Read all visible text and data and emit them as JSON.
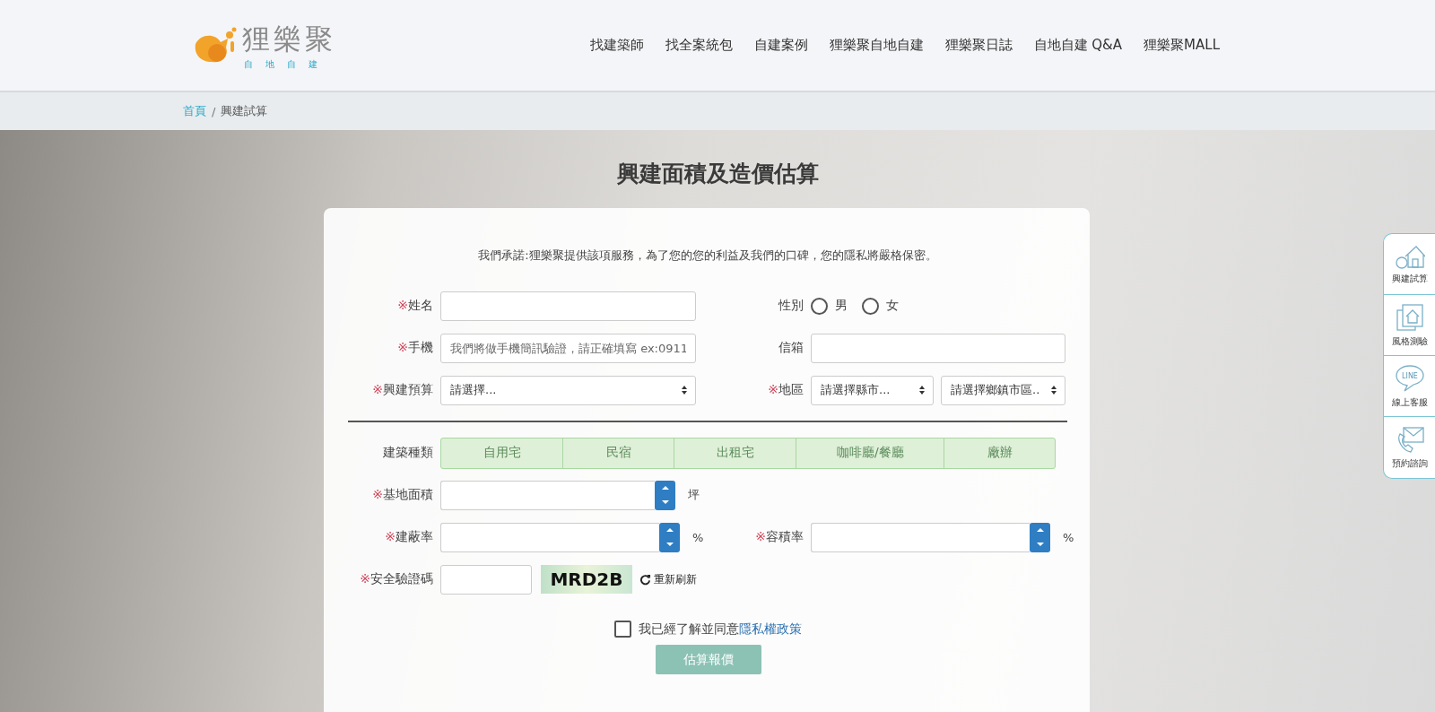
{
  "header": {
    "logo": {
      "name": "狸樂聚",
      "tagline": "自地自建"
    },
    "nav": [
      "找建築師",
      "找全案統包",
      "自建案例",
      "狸樂聚自地自建",
      "狸樂聚日誌",
      "自地自建 Q&A",
      "狸樂聚MALL"
    ]
  },
  "breadcrumb": {
    "separator": "/",
    "items": [
      {
        "label": "首頁",
        "link": true
      },
      {
        "label": "興建試算",
        "link": false
      }
    ]
  },
  "title": "興建面積及造價估算",
  "form": {
    "notice": "我們承諾:狸樂聚提供該項服務，為了您的您的利益及我們的口碑，您的隱私將嚴格保密。",
    "required_mark": "※",
    "name": {
      "label": "姓名",
      "required": true
    },
    "gender": {
      "label": "性別",
      "options": [
        {
          "label": "男",
          "selected": false
        },
        {
          "label": "女",
          "selected": false
        }
      ]
    },
    "phone": {
      "label": "手機",
      "required": true,
      "placeholder": "我們將做手機簡訊驗證，請正確填寫 ex:0911"
    },
    "email": {
      "label": "信箱",
      "required": false
    },
    "budget": {
      "label": "興建預算",
      "required": true,
      "value": "請選擇..."
    },
    "region": {
      "label": "地區",
      "required": true,
      "city": "請選擇縣市...",
      "district": "請選擇鄉鎮市區.."
    },
    "building_type": {
      "label": "建築種類",
      "options": [
        {
          "label": "自用宅",
          "selected": false
        },
        {
          "label": "民宿",
          "selected": false
        },
        {
          "label": "出租宅",
          "selected": false
        },
        {
          "label": "咖啡廳/餐廳",
          "selected": false
        },
        {
          "label": "廠辦",
          "selected": false
        }
      ]
    },
    "site_area": {
      "label": "基地面積",
      "required": true,
      "unit": "坪"
    },
    "coverage": {
      "label": "建蔽率",
      "required": true,
      "unit": "%"
    },
    "far": {
      "label": "容積率",
      "required": true,
      "unit": "%"
    },
    "captcha": {
      "label": "安全驗證碼",
      "required": true,
      "code": "MRD2B",
      "refresh": "重新刷新"
    },
    "agree": {
      "checked": false,
      "text": "我已經了解並同意",
      "link": "隱私權政策"
    },
    "submit": "估算報價"
  },
  "side_tabs": [
    {
      "kind": "calc",
      "label": "興建試算"
    },
    {
      "kind": "style",
      "label": "風格測驗"
    },
    {
      "kind": "line",
      "label": "線上客服",
      "icon_text": "LINE"
    },
    {
      "kind": "mail",
      "label": "預約諮詢"
    }
  ]
}
